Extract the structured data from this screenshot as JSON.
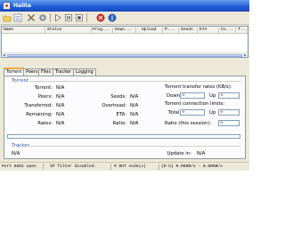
{
  "window": {
    "title": "Halite"
  },
  "toolbar": {
    "buttons": [
      "add-torrent-icon",
      "remove-icon",
      "settings-icon",
      "about-icon",
      "resume-icon",
      "pause-icon",
      "stop-icon",
      "stop-all-icon",
      "about-info-icon"
    ]
  },
  "torrent_list": {
    "columns": [
      "Name",
      "Status",
      "Prog...",
      "Down...",
      "Upload",
      "P...",
      "Seeds",
      "ETA",
      "Co...",
      "T..."
    ]
  },
  "tabs": [
    "Torrent",
    "Peers",
    "Files",
    "Tracker",
    "Logging"
  ],
  "torrent_group": {
    "title": "Torrent",
    "fields": {
      "torrent": {
        "label": "Torrent:",
        "value": "N/A"
      },
      "peers": {
        "label": "Peers:",
        "value": "N/A"
      },
      "transferred": {
        "label": "Transferred:",
        "value": "N/A"
      },
      "remaining": {
        "label": "Remaining:",
        "value": "N/A"
      },
      "rates": {
        "label": "Rates:",
        "value": "N/A"
      },
      "seeds": {
        "label": "Seeds:",
        "value": "N/A"
      },
      "overhead": {
        "label": "Overhead:",
        "value": "N/A"
      },
      "eta": {
        "label": "ETA:",
        "value": "N/A"
      },
      "ratio": {
        "label": "Ratio:",
        "value": "N/A"
      }
    },
    "progress_fraction": 0
  },
  "transfer_rates": {
    "title": "Torrent transfer rates (KB/s):",
    "down_label": "Down",
    "down_value": "∞",
    "up_label": "Up",
    "up_value": "∞"
  },
  "connection_limits": {
    "title": "Torrent connection limits:",
    "total_label": "Total",
    "total_value": "∞",
    "up_label": "Up",
    "up_value": "∞"
  },
  "ratio_session": {
    "label": "Ratio (this session):",
    "value": "∞"
  },
  "tracker_group": {
    "title": "Tracker",
    "value": "N/A",
    "update_label": "Update in:",
    "update_value": "N/A"
  },
  "statusbar": {
    "port": "Port 6881 open",
    "ip_filter": "IP filter disabled.",
    "dht": "0 DHT node(s)",
    "rates": "(D-U) 0.00KB/s - 0.00KB/s"
  },
  "colors": {
    "titlebar": "#1f5fd8",
    "tab_active_accent": "#f2a93b",
    "group_title": "#2f57a8"
  }
}
